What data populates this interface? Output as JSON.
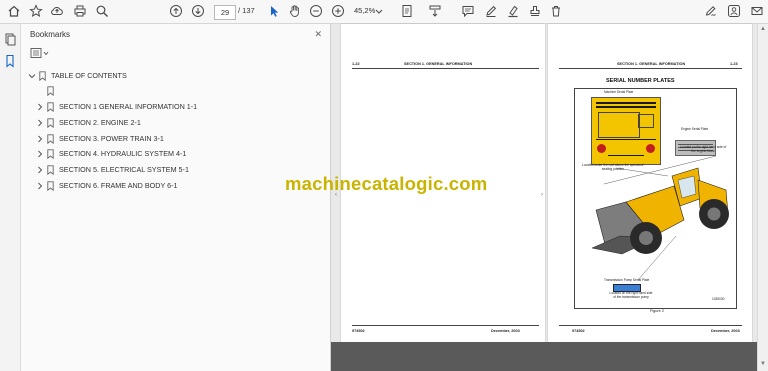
{
  "toolbar": {
    "page_current": "29",
    "page_total": "/ 137",
    "zoom": "45,2%",
    "icons": [
      "home-icon",
      "star-icon",
      "upload-icon",
      "print-icon",
      "zoom-search-icon",
      "page-up-icon",
      "page-down-icon",
      "select-cursor-icon",
      "hand-icon",
      "zoom-out-icon",
      "zoom-in-icon",
      "fit-page-icon",
      "scroll-mode-icon",
      "comment-icon",
      "pen-icon",
      "highlight-icon",
      "stamp-icon",
      "delete-icon",
      "sign-icon",
      "account-icon"
    ]
  },
  "bookmarks": {
    "header": "Bookmarks",
    "close_glyph": "✕",
    "items": [
      {
        "label": "TABLE OF CONTENTS",
        "expanded": true,
        "level": 0
      },
      {
        "label": "",
        "expanded": false,
        "level": 1,
        "chevron": false
      },
      {
        "label": "SECTION 1 GENERAL INFORMATION 1-1",
        "expanded": false,
        "level": 1
      },
      {
        "label": "SECTION 2. ENGINE 2-1",
        "expanded": false,
        "level": 1
      },
      {
        "label": "SECTION 3. POWER TRAIN 3-1",
        "expanded": false,
        "level": 1
      },
      {
        "label": "SECTION 4. HYDRAULIC SYSTEM 4-1",
        "expanded": false,
        "level": 1
      },
      {
        "label": "SECTION 5. ELECTRICAL SYSTEM 5-1",
        "expanded": false,
        "level": 1
      },
      {
        "label": "SECTION 6. FRAME AND BODY 6-1",
        "expanded": false,
        "level": 1
      }
    ]
  },
  "document": {
    "left_page": {
      "number": "1-22",
      "section": "SECTION 1. GENERAL INFORMATION",
      "footer_left": "974502",
      "footer_right": "December, 2003"
    },
    "right_page": {
      "number": "1-23",
      "section": "SECTION 1. GENERAL INFORMATION",
      "title": "SERIAL NUMBER PLATES",
      "label_machine_plate": "Machine Serial Plate",
      "label_engine_plate": "Engine Serial Plate",
      "engine_location_1": "Located on the right hand side of",
      "engine_location_2": "the engine block",
      "machine_location_1": "Located under the roof above the operators'",
      "machine_location_2": "seating position",
      "label_pump_plate": "Transmission Pump Serial Plate",
      "pump_location_1": "Located on the right hand side",
      "pump_location_2": "of the transmission pump",
      "image_ref": "1035030",
      "figure_caption": "Figure 2",
      "footer_left": "974502",
      "footer_right": "December, 2003"
    }
  },
  "watermark": "machinecatalogic.com",
  "colors": {
    "plate_yellow": "#f2c500",
    "machine_yellow": "#f0b400",
    "watermark": "#c9b400",
    "pump_blue": "#3b7fd2"
  }
}
